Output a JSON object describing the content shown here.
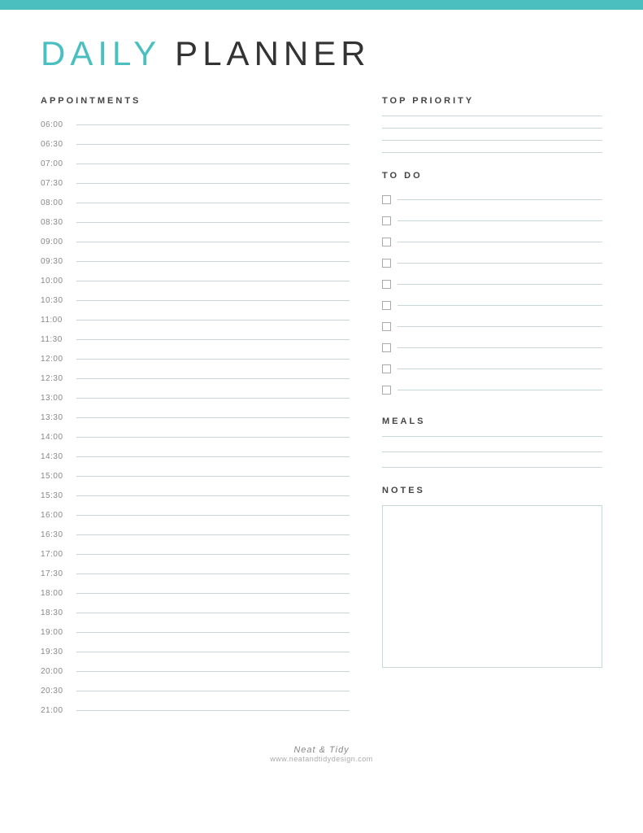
{
  "topBar": {
    "color": "#4bbfbf"
  },
  "title": {
    "daily": "DAILY",
    "planner": " PLANNER"
  },
  "appointments": {
    "sectionTitle": "APPOINTMENTS",
    "times": [
      "06:00",
      "06:30",
      "07:00",
      "07:30",
      "08:00",
      "08:30",
      "09:00",
      "09:30",
      "10:00",
      "10:30",
      "11:00",
      "11:30",
      "12:00",
      "12:30",
      "13:00",
      "13:30",
      "14:00",
      "14:30",
      "15:00",
      "15:30",
      "16:00",
      "16:30",
      "17:00",
      "17:30",
      "18:00",
      "18:30",
      "19:00",
      "19:30",
      "20:00",
      "20:30",
      "21:00"
    ]
  },
  "topPriority": {
    "sectionTitle": "TOP PRIORITY",
    "lines": 4
  },
  "toDo": {
    "sectionTitle": "TO DO",
    "items": 10
  },
  "meals": {
    "sectionTitle": "MEALS",
    "lines": 3
  },
  "notes": {
    "sectionTitle": "NOTES"
  },
  "footer": {
    "brand": "Neat & Tidy",
    "url": "www.neatandtidydesign.com"
  }
}
